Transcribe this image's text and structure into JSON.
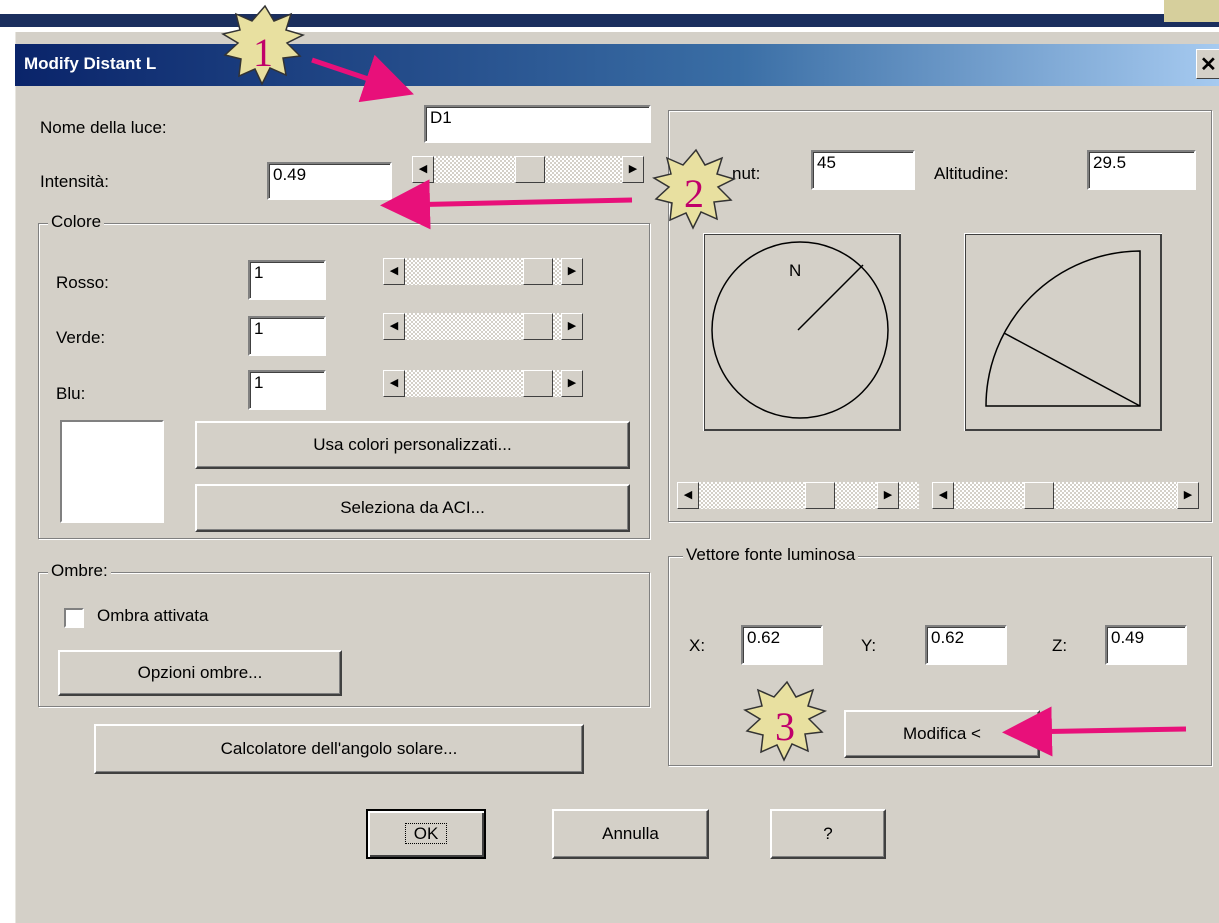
{
  "window": {
    "title": "Modify Distant Light",
    "title_visible": "Modify Distant L"
  },
  "name": {
    "label": "Nome della luce:",
    "value": "D1"
  },
  "intensity": {
    "label": "Intensità:",
    "value": "0.49"
  },
  "color_group": {
    "title": "Colore",
    "red": {
      "label": "Rosso:",
      "value": "1"
    },
    "green": {
      "label": "Verde:",
      "value": "1"
    },
    "blue": {
      "label": "Blu:",
      "value": "1"
    },
    "custom_button": "Usa colori personalizzati...",
    "aci_button": "Seleziona da ACI..."
  },
  "shadows_group": {
    "title": "Ombre:",
    "checkbox_label": "Ombra attivata",
    "checkbox_checked": false,
    "options_button": "Opzioni ombre..."
  },
  "sun_button": "Calcolatore dell'angolo solare...",
  "azimuth": {
    "label": "Azimut:",
    "label_visible": "nut:",
    "value": "45"
  },
  "altitude": {
    "label": "Altitudine:",
    "value": "29.5"
  },
  "compass_letter": "N",
  "vector_group": {
    "title": "Vettore fonte luminosa",
    "x": {
      "label": "X:",
      "value": "0.62"
    },
    "y": {
      "label": "Y:",
      "value": "0.62"
    },
    "z": {
      "label": "Z:",
      "value": "0.49"
    },
    "modify_button": "Modifica <"
  },
  "footer": {
    "ok": "OK",
    "cancel": "Annulla",
    "help": "?"
  },
  "annotations": {
    "badge1": "1",
    "badge2": "2",
    "badge3": "3",
    "arrow_color": "#e8107a",
    "badge_fill": "#e8e0a0"
  }
}
